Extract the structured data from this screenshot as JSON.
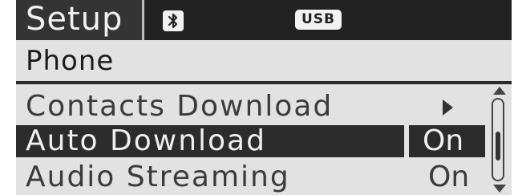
{
  "header": {
    "title": "Setup",
    "status_icons": [
      "bluetooth-icon"
    ],
    "usb_label": "USB"
  },
  "section": {
    "title": "Phone"
  },
  "menu": {
    "items": [
      {
        "label": "Contacts Download",
        "value": "",
        "indicator": "arrow-right-icon",
        "selected": false
      },
      {
        "label": "Auto Download",
        "value": "On",
        "selected": true
      },
      {
        "label": "Audio Streaming",
        "value": "On",
        "selected": false
      }
    ]
  },
  "colors": {
    "background": "#e2e2e2",
    "header_background": "#222222",
    "highlight": "#2c2c2c",
    "text_dark": "#3b3b3b",
    "text_light": "#efefef"
  }
}
